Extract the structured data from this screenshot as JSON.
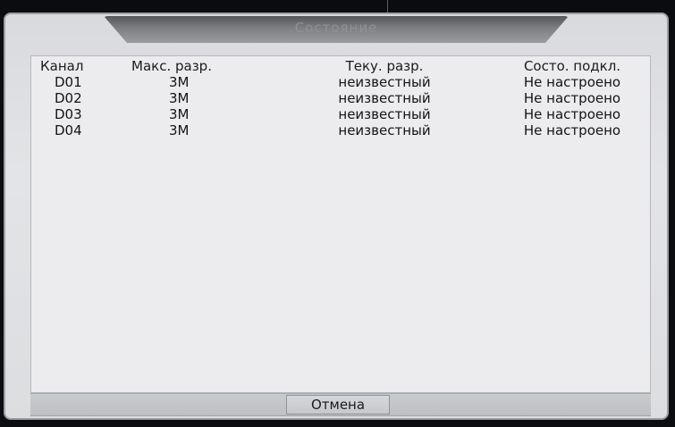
{
  "dialog": {
    "title": "Состояние"
  },
  "table": {
    "headers": [
      "Канал",
      "Макс. разр.",
      "Теку. разр.",
      "Состо. подкл."
    ],
    "rows": [
      [
        "D01",
        "3M",
        "неизвестный",
        "Не настроено"
      ],
      [
        "D02",
        "3M",
        "неизвестный",
        "Не настроено"
      ],
      [
        "D03",
        "3M",
        "неизвестный",
        "Не настроено"
      ],
      [
        "D04",
        "3M",
        "неизвестный",
        "Не настроено"
      ]
    ]
  },
  "footer": {
    "cancel_label": "Отмена"
  }
}
